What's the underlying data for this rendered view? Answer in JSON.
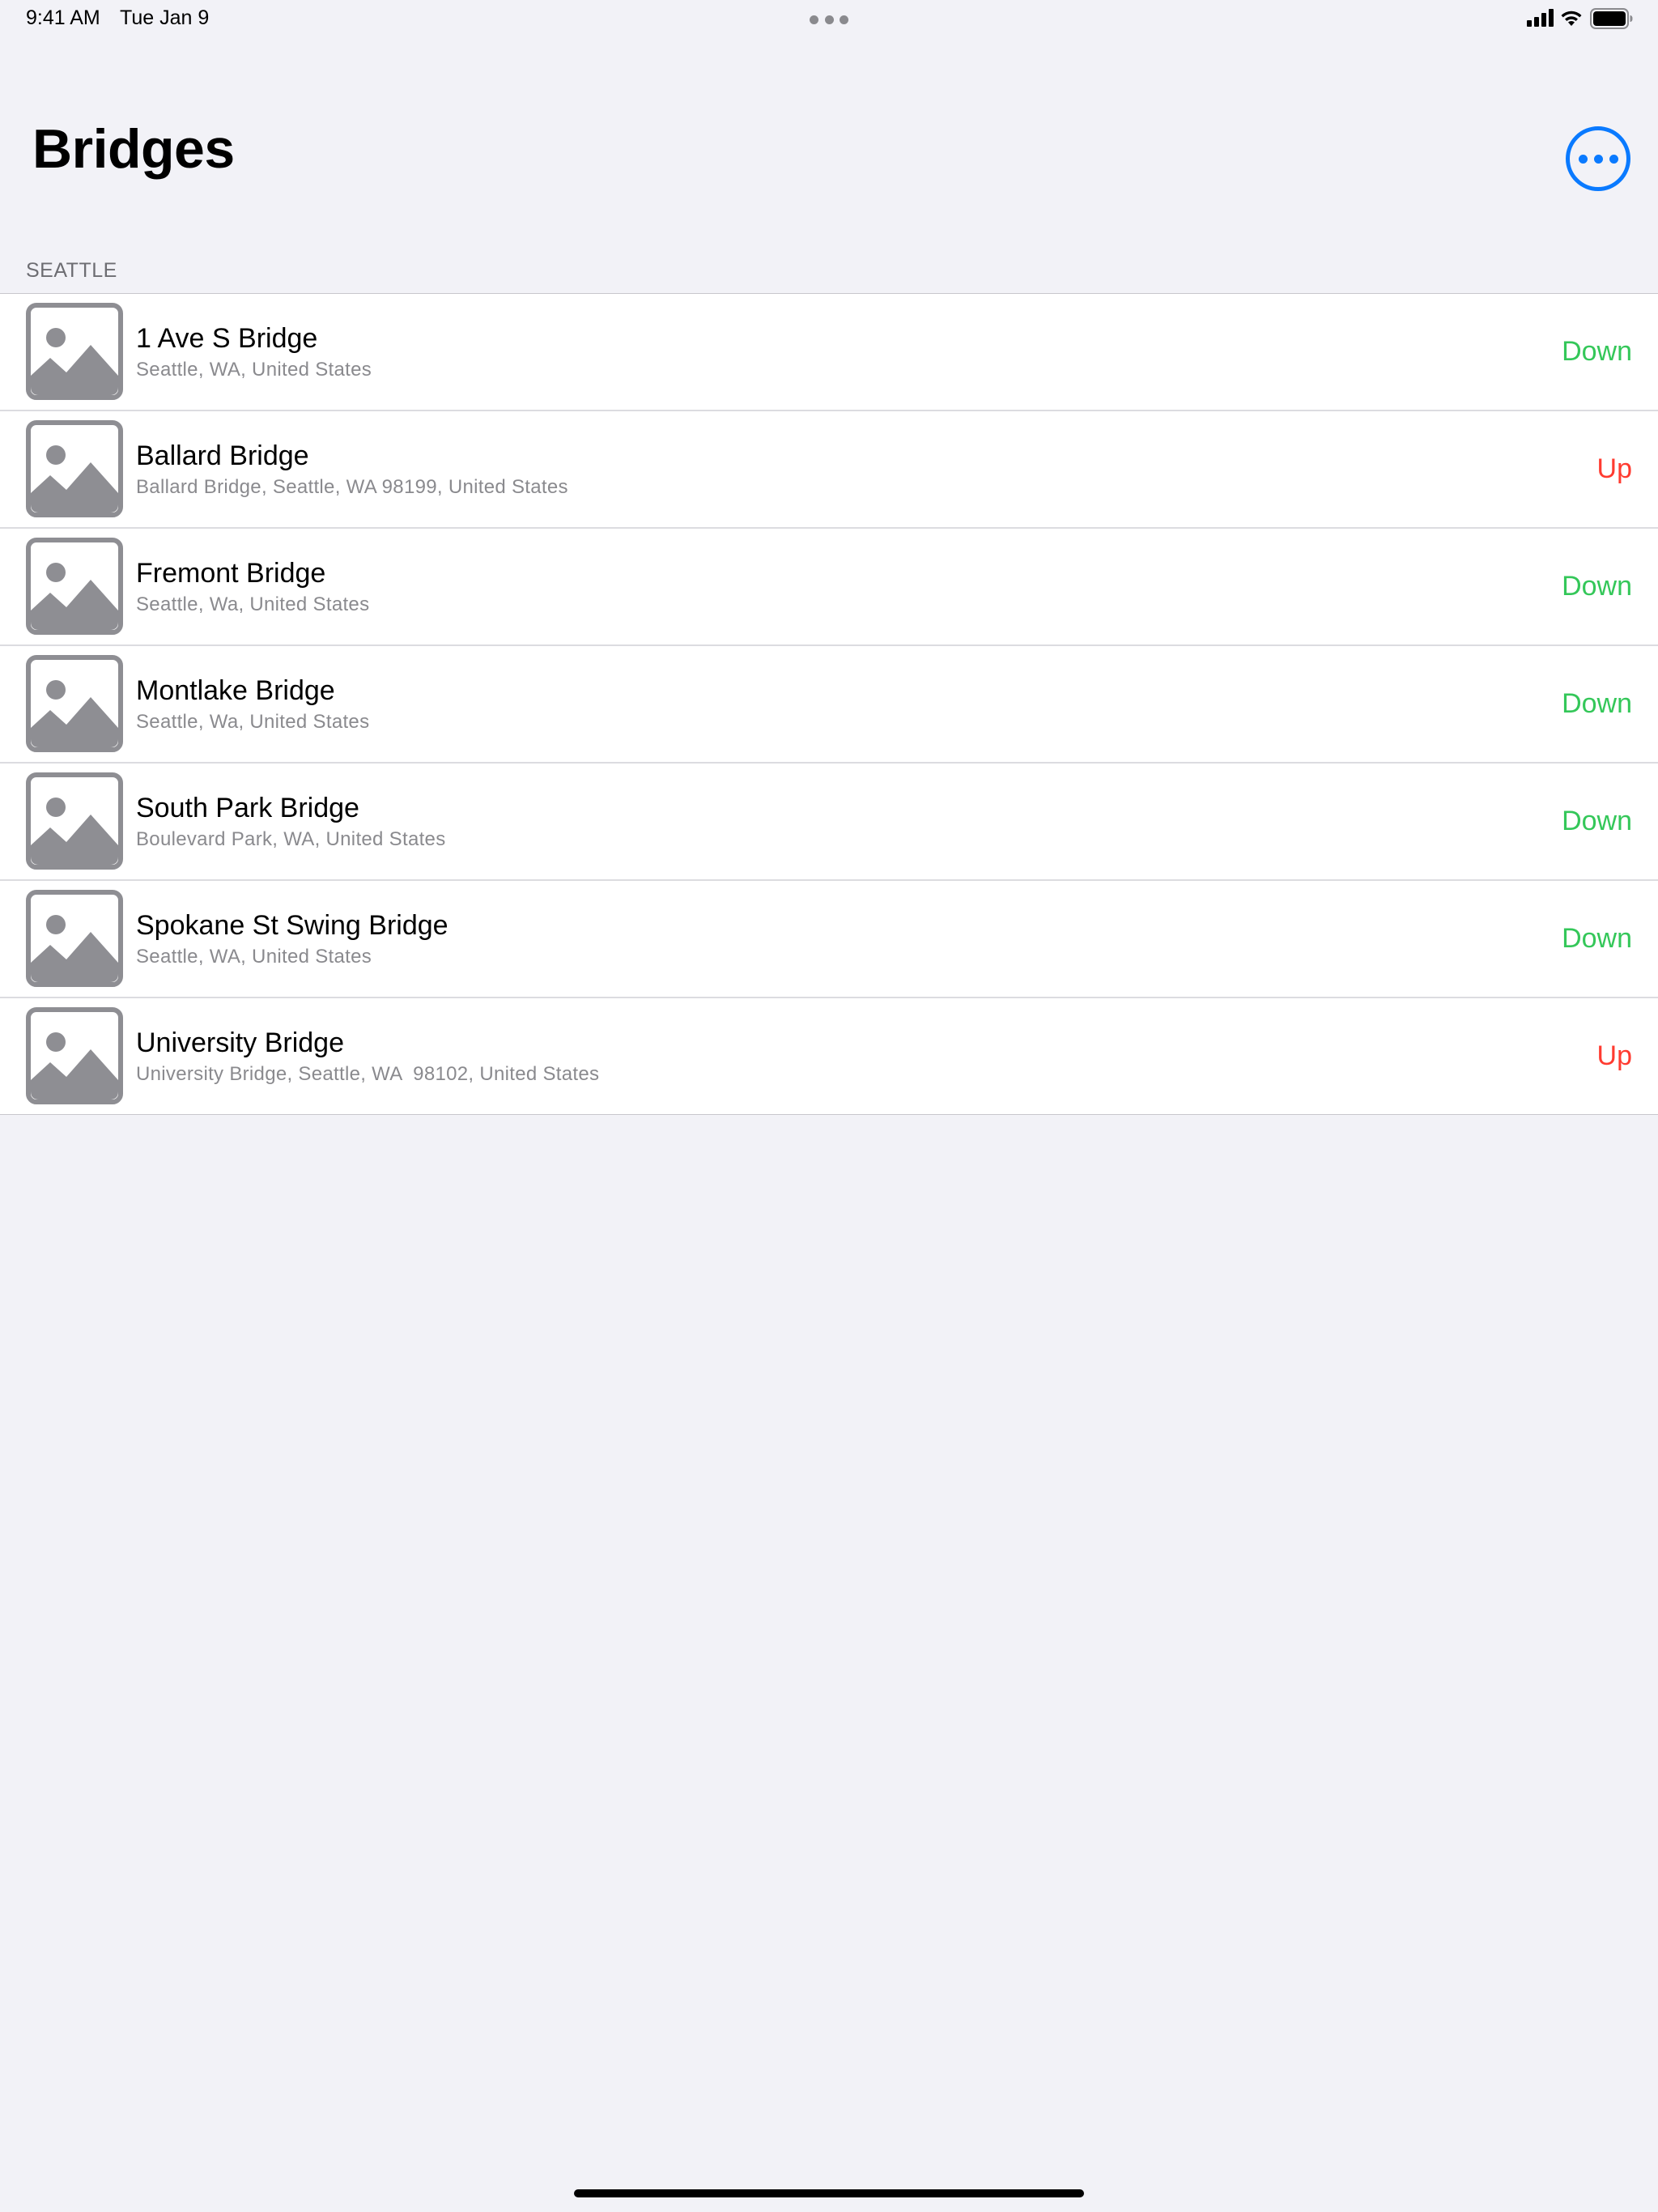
{
  "status_bar": {
    "time": "9:41 AM",
    "date": "Tue Jan 9"
  },
  "header": {
    "title": "Bridges",
    "more_icon": "ellipsis-circle-icon",
    "accent_color": "#0a7aff"
  },
  "section": {
    "label": "SEATTLE"
  },
  "colors": {
    "down": "#34c759",
    "up": "#ff3b30",
    "background": "#f2f2f7",
    "thumbnail": "#8e8e93"
  },
  "bridges": [
    {
      "name": "1 Ave S Bridge",
      "address": "Seattle, WA, United States",
      "status": "Down",
      "thumbnail": "photo-placeholder-icon"
    },
    {
      "name": "Ballard Bridge",
      "address": "Ballard Bridge, Seattle, WA 98199, United States",
      "status": "Up",
      "thumbnail": "photo-placeholder-icon"
    },
    {
      "name": "Fremont Bridge",
      "address": "Seattle, Wa, United States",
      "status": "Down",
      "thumbnail": "photo-placeholder-icon"
    },
    {
      "name": "Montlake Bridge",
      "address": "Seattle, Wa, United States",
      "status": "Down",
      "thumbnail": "photo-placeholder-icon"
    },
    {
      "name": "South Park Bridge",
      "address": "Boulevard Park, WA, United States",
      "status": "Down",
      "thumbnail": "photo-placeholder-icon"
    },
    {
      "name": "Spokane St Swing Bridge",
      "address": "Seattle, WA, United States",
      "status": "Down",
      "thumbnail": "photo-placeholder-icon"
    },
    {
      "name": "University Bridge",
      "address": "University Bridge, Seattle, WA  98102, United States",
      "status": "Up",
      "thumbnail": "photo-placeholder-icon"
    }
  ]
}
